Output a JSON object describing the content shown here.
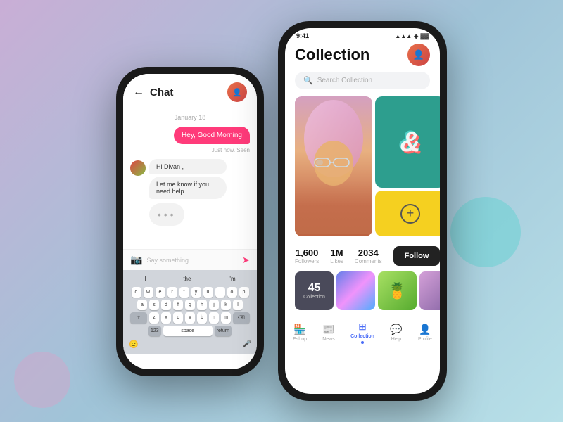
{
  "background": {
    "color_start": "#c9aed6",
    "color_end": "#b8e0e8"
  },
  "left_phone": {
    "header": {
      "back_label": "←",
      "title": "Chat",
      "avatar_emoji": "👤"
    },
    "messages": {
      "date_label": "January 18",
      "sent_msg": "Hey, Good Morning",
      "seen_label": "Just now. Seen",
      "recv_msg_1": "Hi Divan ,",
      "recv_msg_2": "Let me know if you need help",
      "typing_dots": "• • •"
    },
    "input": {
      "placeholder": "Say something...",
      "camera_icon": "📷",
      "send_icon": "➤"
    },
    "keyboard": {
      "suggestions": [
        "I",
        "the",
        "I'm"
      ],
      "row1": [
        "q",
        "w",
        "e",
        "r",
        "t",
        "y",
        "u",
        "i",
        "o",
        "p"
      ],
      "row2": [
        "a",
        "s",
        "d",
        "f",
        "g",
        "h",
        "j",
        "k",
        "l"
      ],
      "row3": [
        "z",
        "x",
        "c",
        "v",
        "b",
        "n",
        "m"
      ],
      "num_label": "123",
      "space_label": "space",
      "return_label": "return",
      "emoji_icon": "🙂",
      "mic_icon": "🎤"
    }
  },
  "right_phone": {
    "status_bar": {
      "time": "9:41",
      "signal": "▲▲▲",
      "wifi": "◈",
      "battery": "▓▓▓"
    },
    "header": {
      "title": "Collection",
      "avatar_emoji": "👤"
    },
    "search": {
      "placeholder": "Search Collection",
      "icon": "🔍"
    },
    "grid": {
      "ampersand": "&",
      "plus_label": "+"
    },
    "stats": {
      "followers_value": "1,600",
      "followers_label": "Followers",
      "likes_value": "1M",
      "likes_label": "Likes",
      "comments_value": "2034",
      "comments_label": "Comments",
      "follow_button": "Follow"
    },
    "thumbnails": {
      "collection_count": "45",
      "collection_label": "Collection",
      "thumb2_emoji": "",
      "thumb3_emoji": "🍍",
      "thumb4_emoji": ""
    },
    "nav": {
      "items": [
        {
          "icon": "🏪",
          "label": "Eshop",
          "active": false
        },
        {
          "icon": "📰",
          "label": "News",
          "active": false
        },
        {
          "icon": "⊞",
          "label": "Collection",
          "active": true
        },
        {
          "icon": "💬",
          "label": "Help",
          "active": false
        },
        {
          "icon": "👤",
          "label": "Profile",
          "active": false
        }
      ]
    }
  }
}
